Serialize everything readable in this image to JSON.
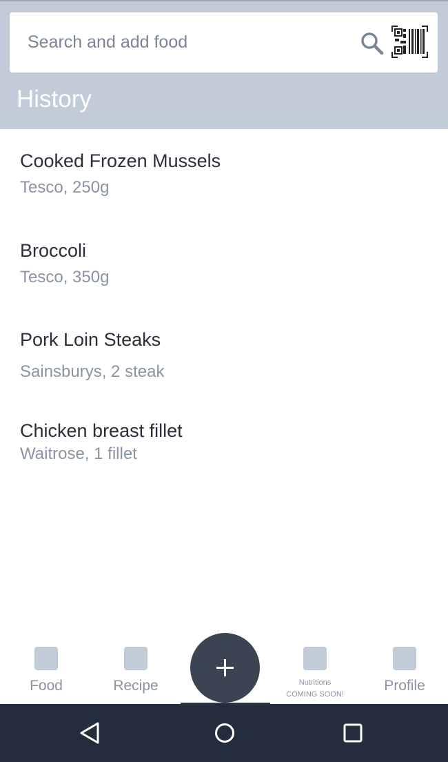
{
  "search": {
    "placeholder": "Search and add food",
    "value": "",
    "search_icon": "search-icon",
    "scan_icon": "barcode-scan-icon"
  },
  "history": {
    "title": "History",
    "items": [
      {
        "name": "Cooked Frozen Mussels",
        "detail": "Tesco, 250g"
      },
      {
        "name": "Broccoli",
        "detail": "Tesco, 350g"
      },
      {
        "name": "Pork Loin Steaks",
        "detail": "Sainsburys, 2 steak"
      },
      {
        "name": "Chicken breast fillet",
        "detail": "Waitrose, 1 fillet"
      }
    ]
  },
  "bottom_nav": {
    "food": "Food",
    "recipe": "Recipe",
    "add_icon": "plus-icon",
    "nutritions_line1": "Nutritions",
    "nutritions_line2": "COMING SOON!",
    "profile": "Profile"
  },
  "system_nav": {
    "back": "back-icon",
    "home": "home-icon",
    "recents": "recents-icon"
  },
  "colors": {
    "header_bg": "#c2ccd8",
    "fab_bg": "#3a4452",
    "system_bar_bg": "#232d3b",
    "secondary_text": "#8a93a1",
    "primary_text": "#2b2f3a"
  }
}
